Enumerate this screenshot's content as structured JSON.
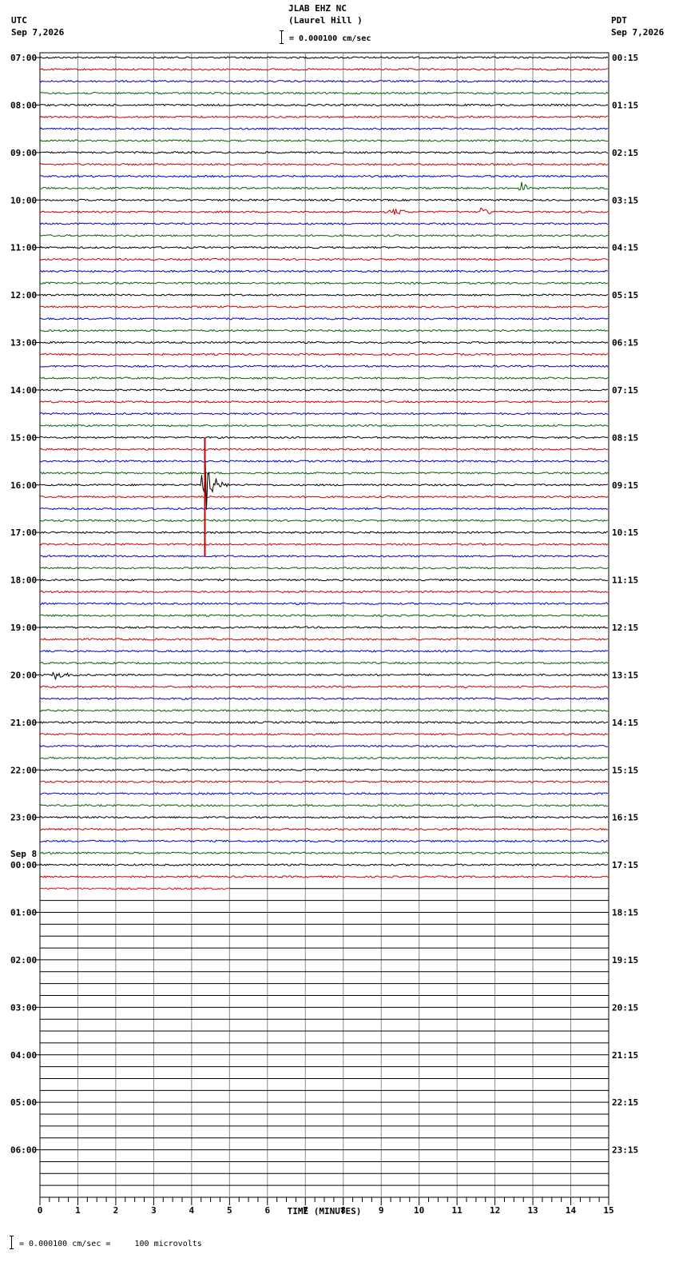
{
  "header": {
    "station_line": "JLAB EHZ NC",
    "station_name": "(Laurel Hill )",
    "scale_text": "= 0.000100 cm/sec",
    "left_tz": "UTC",
    "left_date": "Sep 7,2026",
    "right_tz": "PDT",
    "right_date": "Sep 7,2026"
  },
  "footer": {
    "scale_text": "= 0.000100 cm/sec =     100 microvolts"
  },
  "chart_data": {
    "type": "line",
    "title": "JLAB EHZ NC (Laurel Hill )",
    "xlabel": "TIME (MINUTES)",
    "xlim": [
      0,
      15
    ],
    "x_ticks": [
      "0",
      "1",
      "2",
      "3",
      "4",
      "5",
      "6",
      "7",
      "8",
      "9",
      "10",
      "11",
      "12",
      "13",
      "14",
      "15"
    ],
    "grid": true,
    "left_labels": [
      "07:00",
      "08:00",
      "09:00",
      "10:00",
      "11:00",
      "12:00",
      "13:00",
      "14:00",
      "15:00",
      "16:00",
      "17:00",
      "18:00",
      "19:00",
      "20:00",
      "21:00",
      "22:00",
      "23:00",
      "00:00",
      "01:00",
      "02:00",
      "03:00",
      "04:00",
      "05:00",
      "06:00"
    ],
    "date_change_label": "Sep 8",
    "date_change_index": 17,
    "right_labels": [
      "00:15",
      "01:15",
      "02:15",
      "03:15",
      "04:15",
      "05:15",
      "06:15",
      "07:15",
      "08:15",
      "09:15",
      "10:15",
      "11:15",
      "12:15",
      "13:15",
      "14:15",
      "15:15",
      "16:15",
      "17:15",
      "18:15",
      "19:15",
      "20:15",
      "21:15",
      "22:15",
      "23:15"
    ],
    "trace_colors": [
      "#000000",
      "#cc0000",
      "#0000cc",
      "#006600"
    ],
    "traces_per_hour": 4,
    "recorded_traces": 70,
    "partial_trace_end_minutes": 5,
    "total_traces": 96,
    "events": [
      {
        "trace": 36,
        "minute": 4.35,
        "amplitude": 6,
        "label": "earthquake"
      },
      {
        "trace": 13,
        "minute": 9.3,
        "amplitude": 1
      },
      {
        "trace": 13,
        "minute": 11.6,
        "amplitude": 1
      },
      {
        "trace": 11,
        "minute": 12.7,
        "amplitude": 1
      },
      {
        "trace": 52,
        "minute": 0.4,
        "amplitude": 1
      }
    ]
  }
}
